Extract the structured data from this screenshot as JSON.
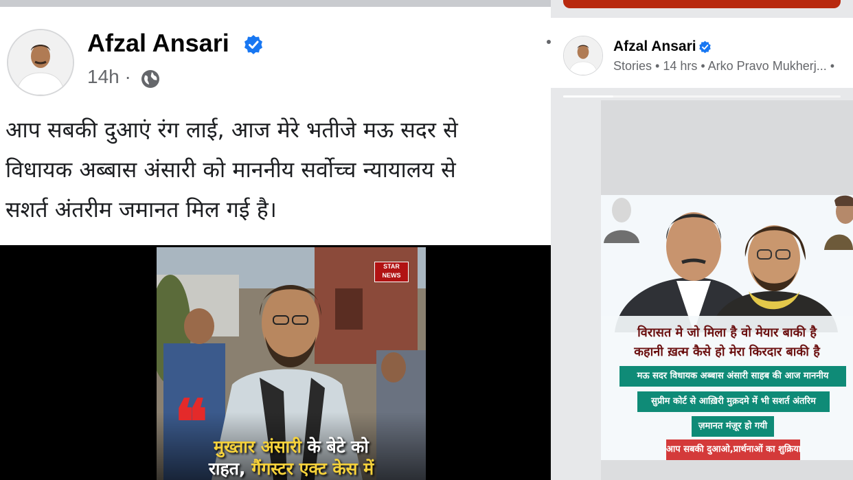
{
  "post": {
    "author": "Afzal Ansari",
    "time": "14h",
    "separator": "·",
    "text_lines": [
      "आप सबकी दुआएं रंग लाई, आज मेरे भतीजे मऊ सदर से",
      "विधायक अब्बास अंसारी को माननीय सर्वोच्च न्यायालय से",
      "सशर्त अंतरीम जमानत मिल गई है।"
    ],
    "video": {
      "channel_logo": "STAR NEWS",
      "caption_line1_yellow": "मुख्तार अंसारी",
      "caption_line1_white": " के बेटे को",
      "caption_line2_white": "राहत, ",
      "caption_line2_yellow": "गैंगस्टर एक्ट केस में"
    }
  },
  "story": {
    "author": "Afzal Ansari",
    "meta": "Stories • 14 hrs • Arko Pravo Mukherj... •",
    "progress": 0.18,
    "poster": {
      "line1": "विरासत मे जो मिला है वो मेयार बाकी है",
      "line2": "कहानी ख़त्म कैसे हो मेरा किरदार बाकी है",
      "strips": [
        "मऊ सदर विधायक अब्बास अंसारी साहब की आज माननीय",
        "सुप्रीम कोर्ट से आख़िरी मुक़दमे में भी सशर्त अंतरिम",
        "ज़मानत मंज़ूर हो गयी",
        "आप सबकी दुआओ,प्रार्थनाओं का शुक्रिया"
      ]
    }
  },
  "icons": {
    "verified": "verified-badge-icon",
    "globe": "public-globe-icon",
    "more": "more-options-icon"
  },
  "colors": {
    "verified_blue": "#1877f2",
    "meta_gray": "#65676b",
    "poster_teal": "#0f8b77",
    "poster_red": "#d43a3a"
  }
}
